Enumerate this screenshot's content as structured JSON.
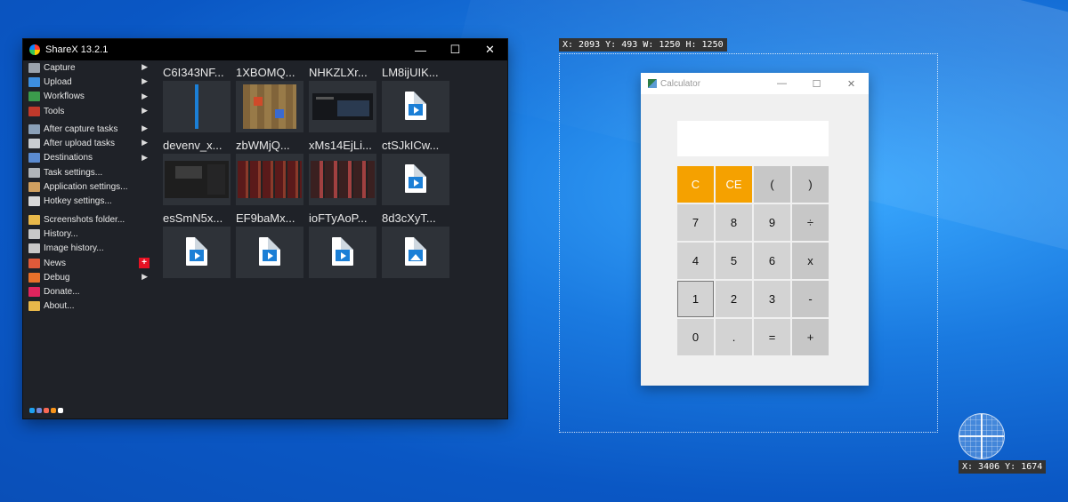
{
  "sharex": {
    "title": "ShareX 13.2.1",
    "window_controls": {
      "minimize": "—",
      "maximize": "☐",
      "close": "✕"
    },
    "menu": [
      {
        "label": "Capture",
        "icon": "capture-icon",
        "color": "#9aa3ad",
        "submenu": true
      },
      {
        "label": "Upload",
        "icon": "upload-arrow-icon",
        "color": "#3d8fe0",
        "submenu": true
      },
      {
        "label": "Workflows",
        "icon": "workflows-grid-icon",
        "color": "#3b9b4c",
        "submenu": true
      },
      {
        "label": "Tools",
        "icon": "toolbox-icon",
        "color": "#c0392b",
        "submenu": true
      },
      {
        "label": "After capture tasks",
        "icon": "after-capture-icon",
        "color": "#8aa0b8",
        "submenu": true
      },
      {
        "label": "After upload tasks",
        "icon": "cloud-icon",
        "color": "#c8ccd0",
        "submenu": true
      },
      {
        "label": "Destinations",
        "icon": "destinations-icon",
        "color": "#5b8bd0",
        "submenu": true
      },
      {
        "label": "Task settings...",
        "icon": "task-settings-gear-icon",
        "color": "#b0b4b8",
        "submenu": false
      },
      {
        "label": "Application settings...",
        "icon": "wrench-icon",
        "color": "#d0a060",
        "submenu": false
      },
      {
        "label": "Hotkey settings...",
        "icon": "keyboard-icon",
        "color": "#d8d8d8",
        "submenu": false
      },
      {
        "label": "Screenshots folder...",
        "icon": "folder-icon",
        "color": "#e8b84a",
        "submenu": false
      },
      {
        "label": "History...",
        "icon": "history-icon",
        "color": "#c8c8c8",
        "submenu": false
      },
      {
        "label": "Image history...",
        "icon": "image-history-icon",
        "color": "#c8c8c8",
        "submenu": false
      },
      {
        "label": "News",
        "icon": "megaphone-icon",
        "color": "#e05a3a",
        "submenu": false,
        "badge": "+"
      },
      {
        "label": "Debug",
        "icon": "traffic-cone-icon",
        "color": "#e8702a",
        "submenu": true
      },
      {
        "label": "Donate...",
        "icon": "heart-icon",
        "color": "#e0245e",
        "submenu": false
      },
      {
        "label": "About...",
        "icon": "crown-icon",
        "color": "#e8b84a",
        "submenu": false
      }
    ],
    "social_icons": [
      "twitter-icon",
      "discord-icon",
      "patreon-icon",
      "bitcoin-icon",
      "github-icon"
    ],
    "social_colors": [
      "#1da1f2",
      "#7289da",
      "#f96854",
      "#f7931a",
      "#ffffff"
    ],
    "thumbnails": [
      {
        "name": "C6I343NF...",
        "kind": "bar"
      },
      {
        "name": "1XBOMQ...",
        "kind": "game"
      },
      {
        "name": "NHKZLXr...",
        "kind": "desktop"
      },
      {
        "name": "LM8ijUIK...",
        "kind": "video"
      },
      {
        "name": "devenv_x...",
        "kind": "ide"
      },
      {
        "name": "zbWMjQ...",
        "kind": "media"
      },
      {
        "name": "xMs14EjLi...",
        "kind": "media2"
      },
      {
        "name": "ctSJkICw...",
        "kind": "video"
      },
      {
        "name": "esSmN5x...",
        "kind": "video"
      },
      {
        "name": "EF9baMx...",
        "kind": "video"
      },
      {
        "name": "ioFTyAoP...",
        "kind": "video"
      },
      {
        "name": "8d3cXyT...",
        "kind": "image"
      }
    ]
  },
  "region_label": "X: 2093 Y: 493 W: 1250 H: 1250",
  "cursor_label": "X: 3406 Y: 1674",
  "calculator": {
    "title": "Calculator",
    "display": "",
    "window_controls": {
      "minimize": "—",
      "maximize": "☐",
      "close": "✕"
    },
    "keys": [
      {
        "label": "C",
        "style": "orange"
      },
      {
        "label": "CE",
        "style": "orange"
      },
      {
        "label": "(",
        "style": "op"
      },
      {
        "label": ")",
        "style": "op"
      },
      {
        "label": "7",
        "style": "num"
      },
      {
        "label": "8",
        "style": "num"
      },
      {
        "label": "9",
        "style": "num"
      },
      {
        "label": "÷",
        "style": "op"
      },
      {
        "label": "4",
        "style": "num"
      },
      {
        "label": "5",
        "style": "num"
      },
      {
        "label": "6",
        "style": "num"
      },
      {
        "label": "x",
        "style": "op"
      },
      {
        "label": "1",
        "style": "sel"
      },
      {
        "label": "2",
        "style": "num"
      },
      {
        "label": "3",
        "style": "num"
      },
      {
        "label": "-",
        "style": "op"
      },
      {
        "label": "0",
        "style": "num"
      },
      {
        "label": ".",
        "style": "num"
      },
      {
        "label": "=",
        "style": "num"
      },
      {
        "label": "+",
        "style": "op"
      }
    ]
  }
}
